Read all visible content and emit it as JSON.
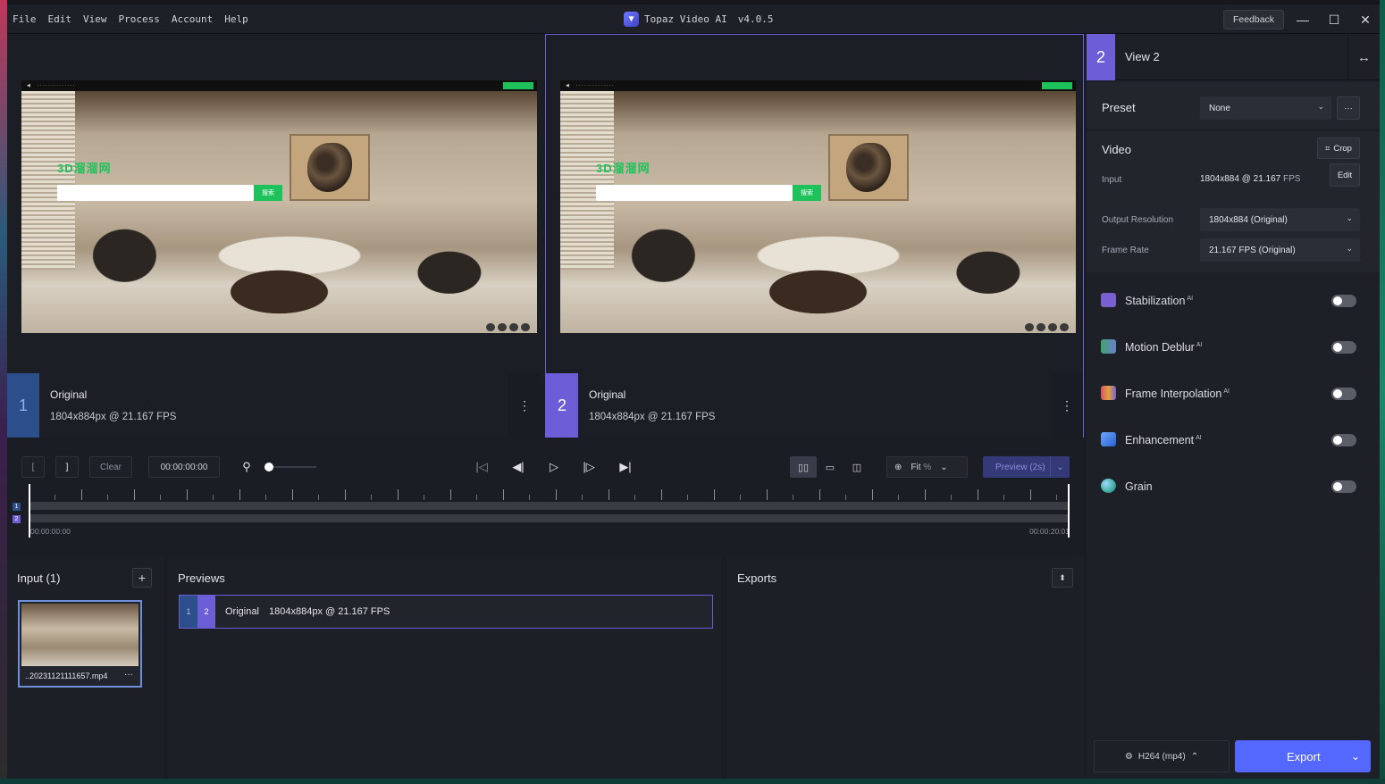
{
  "menu": [
    "File",
    "Edit",
    "View",
    "Process",
    "Account",
    "Help"
  ],
  "app": {
    "title": "Topaz Video AI",
    "version": "v4.0.5"
  },
  "titlebar": {
    "feedback_label": "Feedback"
  },
  "image_overlay": {
    "brand": "3D溜溜网",
    "search_btn": "搜索"
  },
  "views": [
    {
      "number": "1",
      "title": "Original",
      "subtitle": "1804x884px @ 21.167 FPS"
    },
    {
      "number": "2",
      "title": "Original",
      "subtitle": "1804x884px @ 21.167 FPS"
    }
  ],
  "controls": {
    "mark_in": "[",
    "mark_out": "]",
    "clear_label": "Clear",
    "timecode": "00:00:00:00",
    "fit_label": "Fit",
    "fit_unit": "%",
    "preview_label": "Preview (2s)"
  },
  "timeline": {
    "start": "00:00:00:00",
    "end": "00:00:20:01",
    "tracks": [
      "1",
      "2"
    ]
  },
  "input_panel": {
    "title": "Input (1)",
    "file_name": "..20231121111657.mp4"
  },
  "previews_panel": {
    "title": "Previews",
    "row": {
      "badge1": "1",
      "badge2": "2",
      "title": "Original",
      "info": "1804x884px @ 21.167 FPS"
    }
  },
  "exports_panel": {
    "title": "Exports"
  },
  "sidebar": {
    "view_number": "2",
    "view_title": "View 2",
    "preset_label": "Preset",
    "preset_value": "None",
    "video_label": "Video",
    "crop_label": "Crop",
    "input_label": "Input",
    "input_res": "1804x884",
    "input_fps": "@ 21.167",
    "input_fps_unit": "FPS",
    "edit_label": "Edit",
    "output_res_label": "Output Resolution",
    "output_res_value": "1804x884 (Original)",
    "frame_rate_label": "Frame Rate",
    "frame_rate_value": "21.167 FPS (Original)",
    "features": [
      {
        "name": "Stabilization",
        "ai": "AI",
        "color": "#7a5fd0",
        "enabled": false
      },
      {
        "name": "Motion Deblur",
        "ai": "AI",
        "color": "#3fa36a",
        "enabled": false
      },
      {
        "name": "Frame Interpolation",
        "ai": "AI",
        "color": "#d94f6a",
        "enabled": false
      },
      {
        "name": "Enhancement",
        "ai": "AI",
        "color": "#3f79d6",
        "enabled": false
      },
      {
        "name": "Grain",
        "ai": "",
        "color": "#3fb0a0",
        "enabled": false
      }
    ],
    "codec_label": "H264 (mp4)",
    "export_label": "Export"
  },
  "colors": {
    "accent": "#6b5ed6",
    "export": "#5468ff",
    "preview": "#343a78"
  }
}
